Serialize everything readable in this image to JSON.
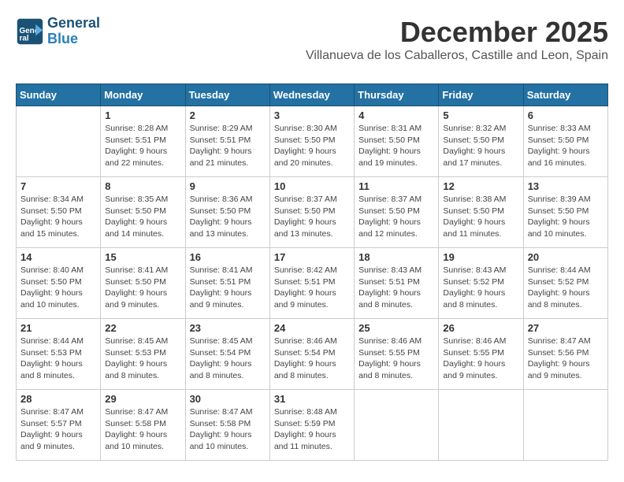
{
  "header": {
    "logo_line1": "General",
    "logo_line2": "Blue",
    "title": "December 2025",
    "subtitle": "Villanueva de los Caballeros, Castille and Leon, Spain"
  },
  "weekdays": [
    "Sunday",
    "Monday",
    "Tuesday",
    "Wednesday",
    "Thursday",
    "Friday",
    "Saturday"
  ],
  "weeks": [
    [
      {
        "day": "",
        "sunrise": "",
        "sunset": "",
        "daylight": ""
      },
      {
        "day": "1",
        "sunrise": "Sunrise: 8:28 AM",
        "sunset": "Sunset: 5:51 PM",
        "daylight": "Daylight: 9 hours and 22 minutes."
      },
      {
        "day": "2",
        "sunrise": "Sunrise: 8:29 AM",
        "sunset": "Sunset: 5:51 PM",
        "daylight": "Daylight: 9 hours and 21 minutes."
      },
      {
        "day": "3",
        "sunrise": "Sunrise: 8:30 AM",
        "sunset": "Sunset: 5:50 PM",
        "daylight": "Daylight: 9 hours and 20 minutes."
      },
      {
        "day": "4",
        "sunrise": "Sunrise: 8:31 AM",
        "sunset": "Sunset: 5:50 PM",
        "daylight": "Daylight: 9 hours and 19 minutes."
      },
      {
        "day": "5",
        "sunrise": "Sunrise: 8:32 AM",
        "sunset": "Sunset: 5:50 PM",
        "daylight": "Daylight: 9 hours and 17 minutes."
      },
      {
        "day": "6",
        "sunrise": "Sunrise: 8:33 AM",
        "sunset": "Sunset: 5:50 PM",
        "daylight": "Daylight: 9 hours and 16 minutes."
      }
    ],
    [
      {
        "day": "7",
        "sunrise": "Sunrise: 8:34 AM",
        "sunset": "Sunset: 5:50 PM",
        "daylight": "Daylight: 9 hours and 15 minutes."
      },
      {
        "day": "8",
        "sunrise": "Sunrise: 8:35 AM",
        "sunset": "Sunset: 5:50 PM",
        "daylight": "Daylight: 9 hours and 14 minutes."
      },
      {
        "day": "9",
        "sunrise": "Sunrise: 8:36 AM",
        "sunset": "Sunset: 5:50 PM",
        "daylight": "Daylight: 9 hours and 13 minutes."
      },
      {
        "day": "10",
        "sunrise": "Sunrise: 8:37 AM",
        "sunset": "Sunset: 5:50 PM",
        "daylight": "Daylight: 9 hours and 13 minutes."
      },
      {
        "day": "11",
        "sunrise": "Sunrise: 8:37 AM",
        "sunset": "Sunset: 5:50 PM",
        "daylight": "Daylight: 9 hours and 12 minutes."
      },
      {
        "day": "12",
        "sunrise": "Sunrise: 8:38 AM",
        "sunset": "Sunset: 5:50 PM",
        "daylight": "Daylight: 9 hours and 11 minutes."
      },
      {
        "day": "13",
        "sunrise": "Sunrise: 8:39 AM",
        "sunset": "Sunset: 5:50 PM",
        "daylight": "Daylight: 9 hours and 10 minutes."
      }
    ],
    [
      {
        "day": "14",
        "sunrise": "Sunrise: 8:40 AM",
        "sunset": "Sunset: 5:50 PM",
        "daylight": "Daylight: 9 hours and 10 minutes."
      },
      {
        "day": "15",
        "sunrise": "Sunrise: 8:41 AM",
        "sunset": "Sunset: 5:50 PM",
        "daylight": "Daylight: 9 hours and 9 minutes."
      },
      {
        "day": "16",
        "sunrise": "Sunrise: 8:41 AM",
        "sunset": "Sunset: 5:51 PM",
        "daylight": "Daylight: 9 hours and 9 minutes."
      },
      {
        "day": "17",
        "sunrise": "Sunrise: 8:42 AM",
        "sunset": "Sunset: 5:51 PM",
        "daylight": "Daylight: 9 hours and 9 minutes."
      },
      {
        "day": "18",
        "sunrise": "Sunrise: 8:43 AM",
        "sunset": "Sunset: 5:51 PM",
        "daylight": "Daylight: 9 hours and 8 minutes."
      },
      {
        "day": "19",
        "sunrise": "Sunrise: 8:43 AM",
        "sunset": "Sunset: 5:52 PM",
        "daylight": "Daylight: 9 hours and 8 minutes."
      },
      {
        "day": "20",
        "sunrise": "Sunrise: 8:44 AM",
        "sunset": "Sunset: 5:52 PM",
        "daylight": "Daylight: 9 hours and 8 minutes."
      }
    ],
    [
      {
        "day": "21",
        "sunrise": "Sunrise: 8:44 AM",
        "sunset": "Sunset: 5:53 PM",
        "daylight": "Daylight: 9 hours and 8 minutes."
      },
      {
        "day": "22",
        "sunrise": "Sunrise: 8:45 AM",
        "sunset": "Sunset: 5:53 PM",
        "daylight": "Daylight: 9 hours and 8 minutes."
      },
      {
        "day": "23",
        "sunrise": "Sunrise: 8:45 AM",
        "sunset": "Sunset: 5:54 PM",
        "daylight": "Daylight: 9 hours and 8 minutes."
      },
      {
        "day": "24",
        "sunrise": "Sunrise: 8:46 AM",
        "sunset": "Sunset: 5:54 PM",
        "daylight": "Daylight: 9 hours and 8 minutes."
      },
      {
        "day": "25",
        "sunrise": "Sunrise: 8:46 AM",
        "sunset": "Sunset: 5:55 PM",
        "daylight": "Daylight: 9 hours and 8 minutes."
      },
      {
        "day": "26",
        "sunrise": "Sunrise: 8:46 AM",
        "sunset": "Sunset: 5:55 PM",
        "daylight": "Daylight: 9 hours and 9 minutes."
      },
      {
        "day": "27",
        "sunrise": "Sunrise: 8:47 AM",
        "sunset": "Sunset: 5:56 PM",
        "daylight": "Daylight: 9 hours and 9 minutes."
      }
    ],
    [
      {
        "day": "28",
        "sunrise": "Sunrise: 8:47 AM",
        "sunset": "Sunset: 5:57 PM",
        "daylight": "Daylight: 9 hours and 9 minutes."
      },
      {
        "day": "29",
        "sunrise": "Sunrise: 8:47 AM",
        "sunset": "Sunset: 5:58 PM",
        "daylight": "Daylight: 9 hours and 10 minutes."
      },
      {
        "day": "30",
        "sunrise": "Sunrise: 8:47 AM",
        "sunset": "Sunset: 5:58 PM",
        "daylight": "Daylight: 9 hours and 10 minutes."
      },
      {
        "day": "31",
        "sunrise": "Sunrise: 8:48 AM",
        "sunset": "Sunset: 5:59 PM",
        "daylight": "Daylight: 9 hours and 11 minutes."
      },
      {
        "day": "",
        "sunrise": "",
        "sunset": "",
        "daylight": ""
      },
      {
        "day": "",
        "sunrise": "",
        "sunset": "",
        "daylight": ""
      },
      {
        "day": "",
        "sunrise": "",
        "sunset": "",
        "daylight": ""
      }
    ]
  ]
}
